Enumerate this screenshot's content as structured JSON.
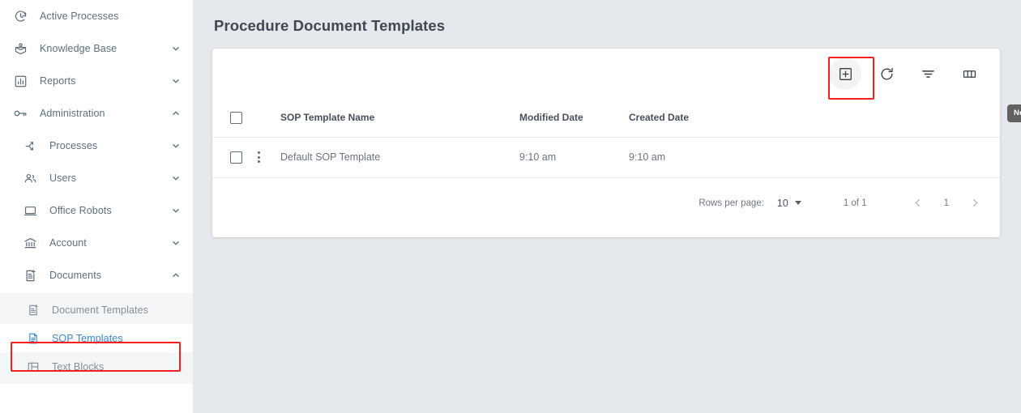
{
  "sidebar": {
    "items": [
      {
        "id": "active-processes",
        "label": "Active Processes",
        "icon": "history-clock-icon",
        "chevron": ""
      },
      {
        "id": "knowledge-base",
        "label": "Knowledge Base",
        "icon": "knowledge-book-icon",
        "chevron": "down"
      },
      {
        "id": "reports",
        "label": "Reports",
        "icon": "bar-chart-icon",
        "chevron": "down"
      },
      {
        "id": "administration",
        "label": "Administration",
        "icon": "key-icon",
        "chevron": "up"
      },
      {
        "id": "processes",
        "label": "Processes",
        "icon": "process-flow-icon",
        "chevron": "down"
      },
      {
        "id": "users",
        "label": "Users",
        "icon": "users-icon",
        "chevron": "down"
      },
      {
        "id": "office-robots",
        "label": "Office Robots",
        "icon": "monitor-icon",
        "chevron": "down"
      },
      {
        "id": "account",
        "label": "Account",
        "icon": "bank-icon",
        "chevron": "down"
      },
      {
        "id": "documents",
        "label": "Documents",
        "icon": "document-plus-icon",
        "chevron": "up"
      }
    ],
    "subitems": [
      {
        "id": "document-templates",
        "label": "Document Templates",
        "icon": "document-plus-icon",
        "active": false
      },
      {
        "id": "sop-templates",
        "label": "SOP Templates",
        "icon": "document-lines-icon",
        "active": true
      },
      {
        "id": "text-blocks",
        "label": "Text Blocks",
        "icon": "text-blocks-icon",
        "active": false
      }
    ],
    "active_color": "#3b86d1",
    "highlight_color": "#f42020"
  },
  "main": {
    "page_title": "Procedure Document Templates",
    "toolbar": {
      "buttons": [
        {
          "id": "new-sop-template",
          "icon": "plus-box-icon",
          "hovered": true
        },
        {
          "id": "refresh",
          "icon": "refresh-icon",
          "hovered": false
        },
        {
          "id": "filter",
          "icon": "filter-icon",
          "hovered": false
        },
        {
          "id": "columns",
          "icon": "columns-icon",
          "hovered": false
        }
      ],
      "tooltip": "New SOP Template"
    },
    "table": {
      "columns": [
        "SOP Template Name",
        "Modified Date",
        "Created Date"
      ],
      "rows": [
        {
          "name": "Default SOP Template",
          "modified": "9:10 am",
          "created": "9:10 am",
          "checked": false
        }
      ]
    },
    "pagination": {
      "rows_per_page_label": "Rows per page:",
      "rows_per_page_value": "10",
      "range": "1 of 1",
      "current_page": "1"
    }
  }
}
